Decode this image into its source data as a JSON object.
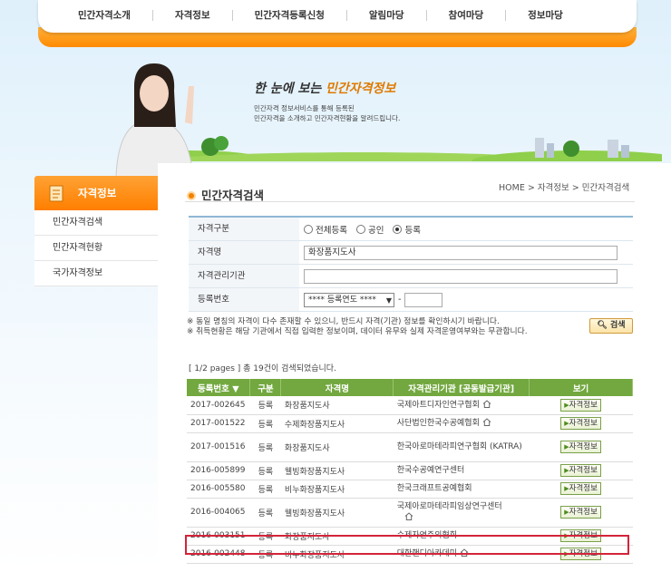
{
  "nav": [
    "민간자격소개",
    "자격정보",
    "민간자격등록신청",
    "알림마당",
    "참여마당",
    "정보마당"
  ],
  "banner": {
    "headline_prefix": "한 눈에 보는 ",
    "headline_highlight": "민간자격정보",
    "desc_line1": "민간자격 정보서비스를 통해 등록된",
    "desc_line2": "민간자격을 소개하고 민간자격현황을 알려드립니다."
  },
  "sidebar": {
    "title": "자격정보",
    "items": [
      "민간자격검색",
      "민간자격현황",
      "국가자격정보"
    ]
  },
  "page": {
    "title": "민간자격검색",
    "breadcrumb": "HOME > 자격정보 > 민간자격검색"
  },
  "form": {
    "type_label": "자격구분",
    "type_options": [
      "전체등록",
      "공인",
      "등록"
    ],
    "type_selected": "등록",
    "name_label": "자격명",
    "name_value": "화장품지도사",
    "org_label": "자격관리기관",
    "org_value": "",
    "regno_label": "등록번호",
    "regno_select": "**** 등록연도 ****",
    "regno_value": ""
  },
  "notes": {
    "line1": "※ 동일 명칭의 자격이 다수 존재할 수 있으니, 반드시 자격(기관) 정보를 확인하시기 바랍니다.",
    "line2": "※ 취득현황은 해당 기관에서 직접 입력한 정보이며, 데이터 유무와 실제 자격운영여부와는 무관합니다."
  },
  "search_button": "검색",
  "result_count": "[ 1/2 pages ] 총 19건이 검색되었습니다.",
  "table": {
    "headers": [
      "등록번호 ▼",
      "구분",
      "자격명",
      "자격관리기관 [공동발급기관]",
      "보기"
    ],
    "view_label": "자격정보",
    "rows": [
      {
        "no": "2017-002645",
        "type": "등록",
        "name": "화장품지도사",
        "org": "국제아트디자인연구협회",
        "home": true
      },
      {
        "no": "2017-001522",
        "type": "등록",
        "name": "수제화장품지도사",
        "org": "사단법인한국수공예협회",
        "home": true
      },
      {
        "no": "2017-001516",
        "type": "등록",
        "name": "화장품지도사",
        "org": "한국아로마테라피연구협회 (KATRA)",
        "home": false
      },
      {
        "no": "2016-005899",
        "type": "등록",
        "name": "웰빙화장품지도사",
        "org": "한국수공예연구센터",
        "home": false
      },
      {
        "no": "2016-005580",
        "type": "등록",
        "name": "비누화장품지도사",
        "org": "한국크래프트공예협회",
        "home": false
      },
      {
        "no": "2016-004065",
        "type": "등록",
        "name": "웰빙화장품지도사",
        "org": "국제아로마테라피임상연구센터",
        "home": true
      },
      {
        "no": "2016-003151",
        "type": "등록",
        "name": "화장품지도사",
        "org": "수제자연주의협회",
        "home": false
      },
      {
        "no": "2016-002448",
        "type": "등록",
        "name": "비누화장품지도사",
        "org": "대한핸디아카데미",
        "home": true
      }
    ]
  }
}
